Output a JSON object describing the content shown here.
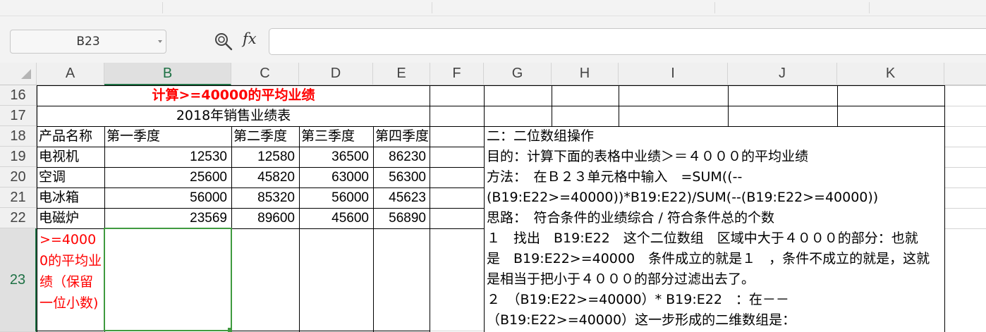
{
  "name_box": "B23",
  "formula_bar": {
    "fx_label": "fx",
    "value": ""
  },
  "columns": [
    "A",
    "B",
    "C",
    "D",
    "E",
    "F",
    "G",
    "H",
    "I",
    "J",
    "K"
  ],
  "selected_column": "B",
  "rows": [
    "16",
    "17",
    "18",
    "19",
    "20",
    "21",
    "22",
    "23"
  ],
  "selected_row": "23",
  "sheet": {
    "title": "计算>=40000的平均业绩",
    "subtitle": "2018年销售业绩表",
    "headers": [
      "产品名称",
      "第一季度",
      "第二季度",
      "第三季度",
      "第四季度"
    ],
    "data": [
      [
        "电视机",
        "12530",
        "12580",
        "36500",
        "86230"
      ],
      [
        "空调",
        "25600",
        "45820",
        "63000",
        "56300"
      ],
      [
        "电冰箱",
        "56000",
        "85320",
        "56000",
        "45623"
      ],
      [
        "电磁炉",
        "23569",
        "89600",
        "45600",
        "56890"
      ]
    ],
    "a23": ">=40000的平均业绩（保留一位小数)"
  },
  "notes": [
    "二：二位数组操作",
    "目的：计算下面的表格中业绩＞＝４０００的平均业绩",
    "方法：　在Ｂ２３单元格中输入　=SUM((--",
    "(B19:E22>=40000))*B19:E22)/SUM(--(B19:E22>=40000))",
    "思路：　符合条件的业绩综合 / 符合条件总的个数",
    "１　找出　B19:E22　这个二位数组　区域中大于４０００的部分：也就",
    "是　B19:E22>=40000　条件成立的就是１　，条件不成立的就是，这就",
    "是相当于把小于４０００的部分过滤出去了。",
    "２　（B19:E22>=40000）* B19:E22　：在－－",
    "（B19:E22>=40000）这一步形成的二维数组是："
  ],
  "colors": {
    "accent_green": "#217346",
    "title_red": "#ff0000"
  },
  "icons": {
    "zoom": "zoom-magnifier-icon",
    "fx": "function-icon",
    "dropdown": "chevron-down-icon"
  }
}
